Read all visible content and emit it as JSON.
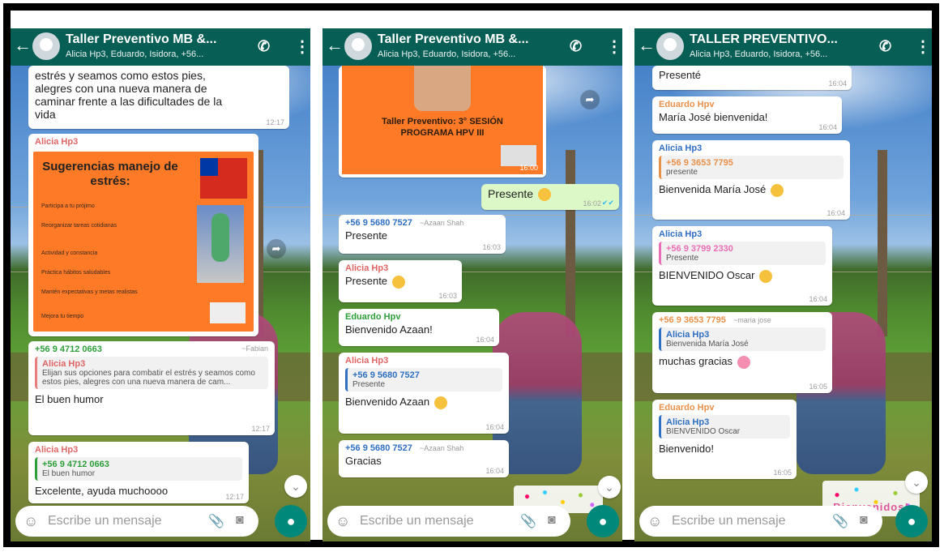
{
  "colors": {
    "header": "#075e54",
    "accent_green": "#00897b",
    "out_bubble": "#dcf8c6"
  },
  "input": {
    "placeholder": "Escribe un mensaje"
  },
  "panels": [
    {
      "header": {
        "title": "Taller Preventivo MB &...",
        "subtitle": "Alicia Hp3, Eduardo, Isidora, +56..."
      },
      "messages": {
        "m1": {
          "text_lines": [
            "estrés y seamos como estos pies,",
            "alegres con una nueva manera de",
            "caminar frente a las dificultades de la",
            "vida"
          ],
          "time": "12:17"
        },
        "m2": {
          "sender": "Alicia Hp3",
          "flyer": {
            "title": "Sugerencias manejo de estrés:",
            "tips": [
              "Participa a tu prójimo",
              "Reorganizar tareas cotidianas",
              "Actividad y constancia",
              "Práctica hábitos saludables",
              "Mantén expectativas y metas realistas",
              "Mejora tu tiempo"
            ]
          }
        },
        "m3": {
          "sender": "+56 9 4712 0663",
          "sender_alias": "~Fabian",
          "quote_sender": "Alicia Hp3",
          "quote_text": "Elijan sus opciones para combatir el estrés y seamos como estos pies, alegres con una nueva manera de cam...",
          "body": "El buen humor",
          "time": "12:17"
        },
        "m4": {
          "sender": "Alicia Hp3",
          "quote_sender": "+56 9 4712 0663",
          "quote_text": "El buen humor",
          "body": "Excelente, ayuda muchoooo",
          "time": "12:17"
        }
      }
    },
    {
      "header": {
        "title": "Taller Preventivo MB &...",
        "subtitle": "Alicia Hp3, Eduardo, Isidora, +56..."
      },
      "messages": {
        "m1": {
          "poster_text": "Taller Preventivo: 3° SESIÓN PROGRAMA HPV III",
          "time": "16:00"
        },
        "m2": {
          "body": "Presente",
          "time": "16:02"
        },
        "m3": {
          "sender": "+56 9 5680 7527",
          "sender_alias": "~Azaan Shah",
          "body": "Presente",
          "time": "16:03"
        },
        "m4": {
          "sender": "Alicia Hp3",
          "body": "Presente",
          "time": "16:03"
        },
        "m5": {
          "sender": "Eduardo Hpv",
          "body": "Bienvenido Azaan!",
          "time": "16:04"
        },
        "m6": {
          "sender": "Alicia Hp3",
          "quote_sender": "+56 9 5680 7527",
          "quote_text": "Presente",
          "body": "Bienvenido Azaan",
          "time": "16:04"
        },
        "m7": {
          "sender": "+56 9 5680 7527",
          "sender_alias": "~Azaan Shah",
          "body": "Gracias",
          "time": "16:04"
        }
      }
    },
    {
      "header": {
        "title": "TALLER PREVENTIVO...",
        "subtitle": "Alicia Hp3, Eduardo, Isidora, +56..."
      },
      "messages": {
        "m1": {
          "body": "Presenté",
          "time": "16:04"
        },
        "m2": {
          "sender": "Eduardo Hpv",
          "body": "María José bienvenida!",
          "time": "16:04"
        },
        "m3": {
          "sender": "Alicia Hp3",
          "quote_sender": "+56 9 3653 7795",
          "quote_text": "presente",
          "body": "Bienvenida María José",
          "time": "16:04"
        },
        "m4": {
          "sender": "Alicia Hp3",
          "quote_sender": "+56 9 3799 2330",
          "quote_text": "Presente",
          "body": "BIENVENIDO Oscar",
          "time": "16:04"
        },
        "m5": {
          "sender": "+56 9 3653 7795",
          "sender_alias": "~maria jose",
          "quote_sender": "Alicia Hp3",
          "quote_text": "Bienvenida María José",
          "body": "muchas gracias",
          "time": "16:05"
        },
        "m6": {
          "sender": "Eduardo Hpv",
          "quote_sender": "Alicia Hp3",
          "quote_text": "BIENVENIDO Oscar",
          "body": "Bienvenido!",
          "time": "16:05"
        },
        "m7": {
          "sticker_text": "Bienvenidos!"
        }
      }
    }
  ],
  "icons": {
    "back": "arrow-left-icon",
    "call": "add-call-icon",
    "menu": "more-vert-icon",
    "emoji": "smiley-icon",
    "attach": "paperclip-icon",
    "camera": "camera-icon",
    "mic": "mic-icon",
    "forward": "forward-icon",
    "scroll": "chevron-down-icon"
  }
}
